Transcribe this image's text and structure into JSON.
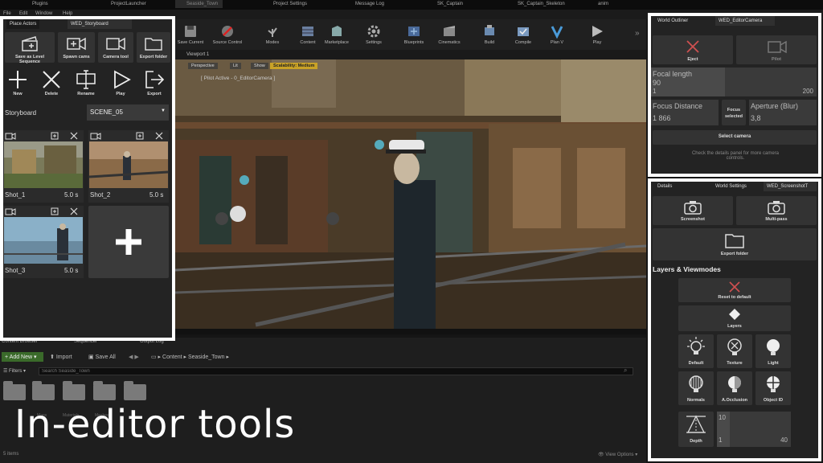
{
  "window_tabs": [
    "Plugins",
    "ProjectLauncher",
    "Seaside_Town",
    "Project Settings",
    "Message Log",
    "SK_Captain",
    "SK_Captain_Skeleton",
    "anim"
  ],
  "menu": [
    "File",
    "Edit",
    "Window",
    "Help"
  ],
  "toolbar": [
    {
      "label": "Save Current",
      "icon": "save-icon"
    },
    {
      "label": "Source Control",
      "icon": "source-control-icon"
    },
    {
      "label": "Modes",
      "icon": "modes-icon"
    },
    {
      "label": "Content",
      "icon": "content-icon"
    },
    {
      "label": "Marketplace",
      "icon": "marketplace-icon"
    },
    {
      "label": "Settings",
      "icon": "gear-icon"
    },
    {
      "label": "Blueprints",
      "icon": "blueprint-icon"
    },
    {
      "label": "Cinematics",
      "icon": "cinematics-icon"
    },
    {
      "label": "Build",
      "icon": "build-icon"
    },
    {
      "label": "Compile",
      "icon": "compile-icon"
    },
    {
      "label": "Plan V",
      "icon": "plan-icon"
    },
    {
      "label": "Play",
      "icon": "play-icon"
    }
  ],
  "viewport": {
    "tab": "Viewport 1",
    "buttons": [
      "Perspective",
      "Lit",
      "Show"
    ],
    "scalability": "Scalability: Medium",
    "pilot": "[ Pilot Active - 0_EditorCamera ]"
  },
  "storyboard_panel": {
    "tabs": [
      "Place Actors",
      "WED_Storyboard"
    ],
    "top_buttons": [
      {
        "label": "Save as Level Sequence",
        "icon": "clapperboard-icon"
      },
      {
        "label": "Spawn cams",
        "icon": "camera-plus-icon"
      },
      {
        "label": "Camera tool",
        "icon": "camera-icon"
      },
      {
        "label": "Export folder",
        "icon": "folder-icon"
      }
    ],
    "action_buttons": [
      {
        "label": "New",
        "icon": "plus-icon"
      },
      {
        "label": "Delete",
        "icon": "x-icon"
      },
      {
        "label": "Rename",
        "icon": "rename-icon"
      },
      {
        "label": "Play",
        "icon": "play-icon"
      },
      {
        "label": "Export",
        "icon": "export-icon"
      }
    ],
    "storyboard_label": "Storyboard",
    "scene_select": "SCENE_05",
    "shots": [
      {
        "name": "Shot_1",
        "duration": "5.0 s"
      },
      {
        "name": "Shot_2",
        "duration": "5.0 s"
      },
      {
        "name": "Shot_3",
        "duration": "5.0 s"
      }
    ]
  },
  "camera_panel": {
    "tabs": [
      "World Outliner",
      "WED_EditorCamera"
    ],
    "eject": "Eject",
    "pilot": "Pilot",
    "focal_length_label": "Focal length",
    "focal_length_value": "90",
    "focal_min": "1",
    "focal_max": "200",
    "focus_distance_label": "Focus Distance",
    "focus_distance_value": "1 866",
    "focus_selected": "Focus selected",
    "aperture_label": "Aperture (Blur)",
    "aperture_value": "3,8",
    "select_camera": "Select camera",
    "hint": "Check the details panel for more camera controls."
  },
  "screenshot_panel": {
    "tabs": [
      "Details",
      "World Settings",
      "WED_ScreenshotT"
    ],
    "screenshot": "Screenshot",
    "multipass": "Multi-pass",
    "export_folder": "Export folder",
    "section_title": "Layers & Viewmodes",
    "reset": "Reset to default",
    "layers": "Layers",
    "modes": [
      {
        "label": "Default",
        "icon": "lightbulb-rays-icon"
      },
      {
        "label": "Texture",
        "icon": "texture-icon"
      },
      {
        "label": "Light",
        "icon": "light-bulb-icon"
      },
      {
        "label": "Normals",
        "icon": "normals-icon"
      },
      {
        "label": "A.Occlusion",
        "icon": "occlusion-icon"
      },
      {
        "label": "Object ID",
        "icon": "object-id-icon"
      }
    ],
    "depth": "Depth",
    "depth_top": "10",
    "depth_min": "1",
    "depth_max": "40"
  },
  "content_browser": {
    "tabs": [
      "Content Browser",
      "Sequencer",
      "Output Log"
    ],
    "add_new": "Add New",
    "import": "Import",
    "save_all": "Save All",
    "path": [
      "Content",
      "Seaside_Town"
    ],
    "filters": "Filters",
    "search_placeholder": "Search Seaside_Town",
    "folders": [
      "Maps",
      "Materials",
      "Meshes"
    ],
    "status": "5 items",
    "view_options": "View Options"
  },
  "overlay_title": "In-editor tools"
}
